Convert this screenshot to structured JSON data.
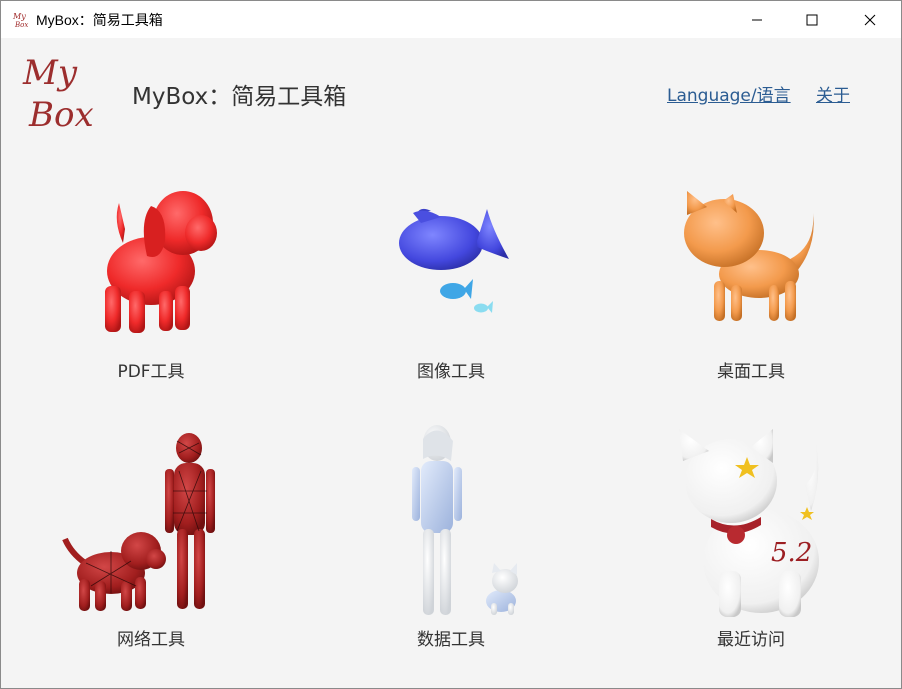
{
  "window": {
    "title": "MyBox：简易工具箱",
    "icon": "mybox-app-icon",
    "controls": {
      "minimize": "minimize-icon",
      "maximize": "maximize-icon",
      "close": "close-icon"
    }
  },
  "header": {
    "logo_text_line1": "My",
    "logo_text_line2": "Box",
    "title": "MyBox：简易工具箱",
    "links": {
      "language": "Language/语言",
      "about": "关于"
    },
    "link_color": "#2b5c92"
  },
  "tools": {
    "pdf": {
      "label": "PDF工具",
      "icon": "red-dog-icon",
      "color": "#e8292c"
    },
    "image": {
      "label": "图像工具",
      "icon": "blue-fish-icon",
      "color": "#4a4ee0"
    },
    "desktop": {
      "label": "桌面工具",
      "icon": "orange-cat-icon",
      "color": "#f0984a"
    },
    "network": {
      "label": "网络工具",
      "icon": "spider-dog-and-person-icon",
      "color": "#a82222"
    },
    "data": {
      "label": "数据工具",
      "icon": "girl-and-cat-icon",
      "color": "#d8e2f2"
    },
    "recent": {
      "label": "最近访问",
      "icon": "lucky-cat-icon",
      "color": "#f6f6f6"
    }
  }
}
